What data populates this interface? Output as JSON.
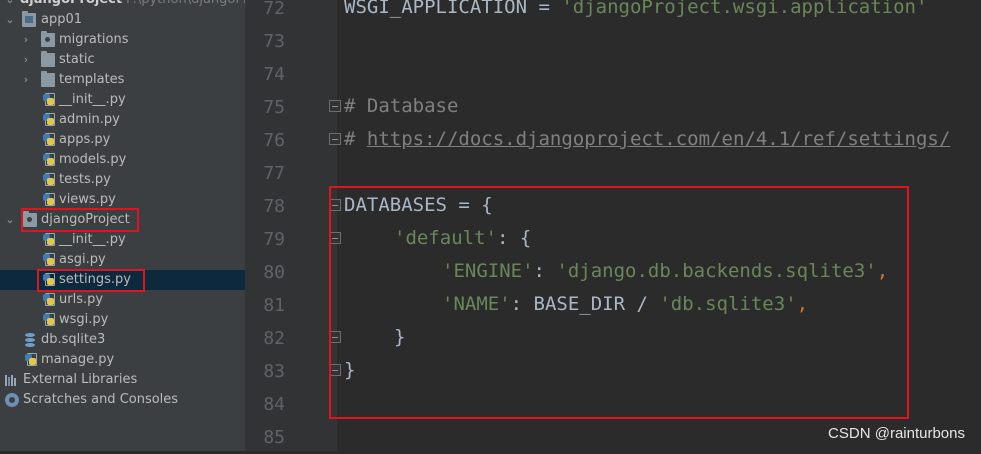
{
  "tree": {
    "root": {
      "label": "djangoProject",
      "path": "F:\\python\\djangoProje"
    },
    "app": "app01",
    "app_children": {
      "migrations": "migrations",
      "static": "static",
      "templates": "templates",
      "init": "__init__.py",
      "admin": "admin.py",
      "apps": "apps.py",
      "models": "models.py",
      "tests": "tests.py",
      "views": "views.py"
    },
    "project_pkg": "djangoProject",
    "pkg_children": {
      "init": "__init__.py",
      "asgi": "asgi.py",
      "settings": "settings.py",
      "urls": "urls.py",
      "wsgi": "wsgi.py"
    },
    "db": "db.sqlite3",
    "manage": "manage.py",
    "external": "External Libraries",
    "scratches": "Scratches and Consoles"
  },
  "editor": {
    "line_numbers": [
      "72",
      "73",
      "74",
      "75",
      "76",
      "77",
      "78",
      "79",
      "80",
      "81",
      "82",
      "83",
      "84",
      "85"
    ],
    "l72": {
      "a": "WSGI_APPLICATION = ",
      "b": "'djangoProject.wsgi.application'"
    },
    "l75": "# Database",
    "l76": {
      "a": "# ",
      "b": "https://docs.djangoproject.com/en/4.1/ref/settings/"
    },
    "l78": {
      "a": "DATABASES = {"
    },
    "l79": {
      "a": "'default'",
      "b": ": {"
    },
    "l80": {
      "a": "'ENGINE'",
      "b": ": ",
      "c": "'django.db.backends.sqlite3'",
      "d": ","
    },
    "l81": {
      "a": "'NAME'",
      "b": ": BASE_DIR / ",
      "c": "'db.sqlite3'",
      "d": ","
    },
    "l82": "}",
    "l83": "}"
  },
  "watermark": "CSDN @rainturbons",
  "colors": {
    "highlight": "#e0141e",
    "string": "#6a8759",
    "comment": "#808080",
    "selection": "#0d293e"
  }
}
